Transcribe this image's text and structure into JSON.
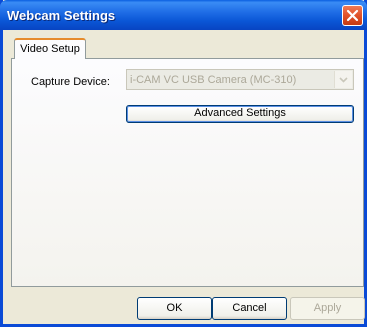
{
  "window": {
    "title": "Webcam Settings"
  },
  "tabs": [
    {
      "label": "Video Setup"
    }
  ],
  "video_setup": {
    "capture_device_label": "Capture Device:",
    "capture_device_value": "i-CAM VC USB Camera (MC-310)",
    "advanced_settings_label": "Advanced Settings"
  },
  "buttons": {
    "ok": "OK",
    "cancel": "Cancel",
    "apply": "Apply"
  },
  "colors": {
    "titlebar": "#0a56d6",
    "close": "#e0522a",
    "tab_accent": "#e68b2c",
    "dialog_bg": "#ece9d8"
  }
}
